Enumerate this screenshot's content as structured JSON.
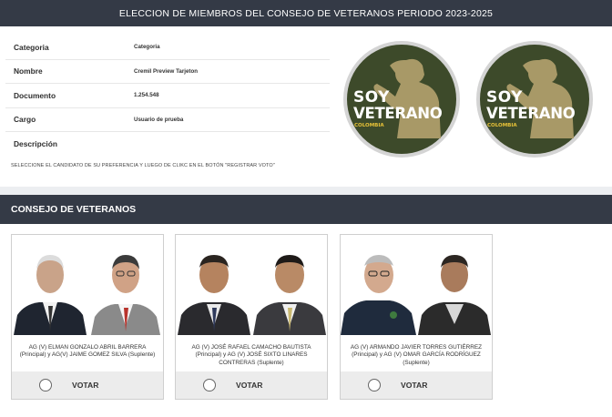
{
  "header": {
    "title": "ELECCION DE MIEMBROS DEL CONSEJO DE VETERANOS PERIODO 2023-2025"
  },
  "info": {
    "rows": [
      {
        "label": "Categoria",
        "value": "Categoria"
      },
      {
        "label": "Nombre",
        "value": "Cremil Preview Tarjeton"
      },
      {
        "label": "Documento",
        "value": "1.254.548"
      },
      {
        "label": "Cargo",
        "value": "Usuario de prueba"
      },
      {
        "label": "Descripción",
        "value": ""
      }
    ],
    "instruction": "SELECCIONE EL CANDIDATO DE SU PREFERENCIA Y LUEGO DE CLIKC EN EL BOTÓN \"REGISTRAR VOTO\""
  },
  "logo": {
    "line1": "SOY",
    "line2": "VETERANO",
    "line3": "COLOMBIA",
    "bg_color": "#3d4a2a",
    "ring_color": "#cfcfcf"
  },
  "section": {
    "title": "CONSEJO DE VETERANOS"
  },
  "candidates": [
    {
      "names": "AG (V) ELMAN GONZALO ABRIL BARRERA (Principal) y AG(V) JAIME GOMEZ SILVA (Suplente)",
      "vote_label": "VOTAR"
    },
    {
      "names": "AG (V) JOSÉ RAFAEL CAMACHO BAUTISTA (Principal) y AG (V) JOSÉ SIXTO LINARES CONTRERAS (Suplente)",
      "vote_label": "VOTAR"
    },
    {
      "names": "AG (V) ARMANDO JAVIER TORRES GUTIÉRREZ (Principal) y AG (V) OMAR GARCÍA RODRÍGUEZ (Suplente)",
      "vote_label": "VOTAR"
    }
  ]
}
